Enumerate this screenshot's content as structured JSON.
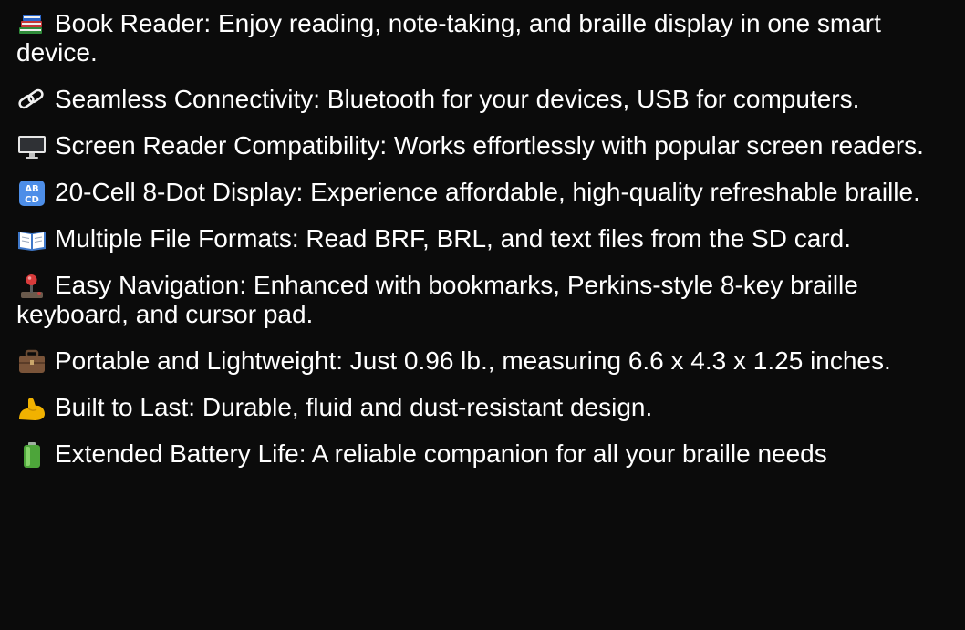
{
  "features": [
    {
      "icon": "books-icon",
      "text": "Book Reader: Enjoy reading, note-taking, and braille display in one smart device."
    },
    {
      "icon": "link-icon",
      "text": "Seamless Connectivity: Bluetooth for your devices, USB for computers."
    },
    {
      "icon": "desktop-computer-icon",
      "text": "Screen Reader Compatibility: Works effortlessly with popular screen readers."
    },
    {
      "icon": "abcd-input-icon",
      "text": "20-Cell 8-Dot Display: Experience affordable, high-quality refreshable braille."
    },
    {
      "icon": "open-book-icon",
      "text": "Multiple File Formats: Read BRF, BRL, and text files from the SD card."
    },
    {
      "icon": "joystick-icon",
      "text": "Easy Navigation: Enhanced with bookmarks, Perkins-style 8-key braille keyboard, and cursor pad."
    },
    {
      "icon": "briefcase-icon",
      "text": "Portable and Lightweight: Just 0.96 lb., measuring 6.6 x 4.3 x 1.25 inches."
    },
    {
      "icon": "flexed-biceps-icon",
      "text": "Built to Last: Durable, fluid and dust-resistant design."
    },
    {
      "icon": "battery-icon",
      "text": "Extended Battery Life: A reliable companion for all your braille needs"
    }
  ],
  "colors": {
    "background": "#0b0b0b",
    "text": "#ffffff"
  }
}
